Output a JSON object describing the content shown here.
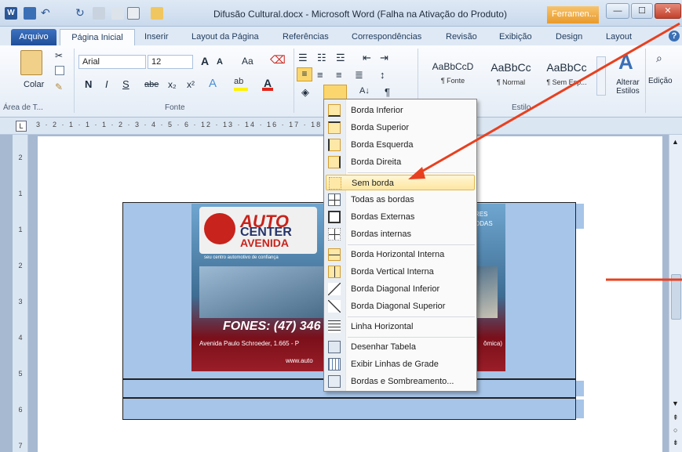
{
  "titlebar": {
    "title": "Difusão Cultural.docx - Microsoft Word (Falha na Ativação do Produto)",
    "context_tab": "Ferramen...",
    "min": "—",
    "max": "☐",
    "close": "✕"
  },
  "tabs": {
    "arquivo": "Arquivo",
    "inicio": "Página Inicial",
    "inserir": "Inserir",
    "layout_pagina": "Layout da Página",
    "referencias": "Referências",
    "correspondencias": "Correspondências",
    "revisao": "Revisão",
    "exibicao": "Exibição",
    "design": "Design",
    "layout": "Layout"
  },
  "ribbon": {
    "paste_label": "Colar",
    "clipboard_group": "Área de T...",
    "font_name": "Arial",
    "font_size": "12",
    "font_group": "Fonte",
    "bold": "N",
    "italic": "I",
    "underline": "S",
    "strike": "abe",
    "subscript": "x₂",
    "superscript": "x²",
    "grow": "A",
    "shrink": "A",
    "case": "Aa",
    "styles_group": "Estilo",
    "styles": [
      {
        "sample": "AaBbCcD⁠",
        "name": "¶ Fonte"
      },
      {
        "sample": "AaBbCc",
        "name": "¶ Normal"
      },
      {
        "sample": "AaBbCc",
        "name": "¶ Sem Esp..."
      }
    ],
    "alter_styles": "Alterar Estilos",
    "editing": "Edição",
    "pilcrow": "¶",
    "sort": "A↓"
  },
  "ruler": {
    "numbers": "3 · 2 · 1 · 1 · 1 · 2 · 3 · 4 · 5 · 6 · 12 · 13 · 14 · 16 · 17 · 18",
    "vertical": "2 1 1 2 3 4 5 6 7"
  },
  "banner": {
    "auto": "AUTO",
    "center": "CENTER",
    "avenida": "AVENIDA",
    "tagline": "seu centro automotivo de confiança",
    "fones": "FONES: (47) 346",
    "address": "Avenida Paulo Schroeder, 1.665 - P",
    "www": "www.auto",
    "right_text": "RES\nODAS",
    "right_bottom": "ômica)"
  },
  "menu": {
    "items": [
      {
        "label": "Borda Inferior",
        "icon": "border-bottom-icon"
      },
      {
        "label": "Borda Superior",
        "icon": "border-top-icon"
      },
      {
        "label": "Borda Esquerda",
        "icon": "border-left-icon"
      },
      {
        "label": "Borda Direita",
        "icon": "border-right-icon"
      },
      {
        "label": "Sem borda",
        "icon": "no-border-icon"
      },
      {
        "label": "Todas as bordas",
        "icon": "all-borders-icon"
      },
      {
        "label": "Bordas Externas",
        "icon": "outside-borders-icon"
      },
      {
        "label": "Bordas internas",
        "icon": "inside-borders-icon"
      },
      {
        "label": "Borda Horizontal Interna",
        "icon": "inside-horizontal-border-icon"
      },
      {
        "label": "Borda Vertical Interna",
        "icon": "inside-vertical-border-icon"
      },
      {
        "label": "Borda Diagonal Inferior",
        "icon": "diagonal-down-border-icon"
      },
      {
        "label": "Borda Diagonal Superior",
        "icon": "diagonal-up-border-icon"
      },
      {
        "label": "Linha Horizontal",
        "icon": "horizontal-line-icon"
      },
      {
        "label": "Desenhar Tabela",
        "icon": "draw-table-icon"
      },
      {
        "label": "Exibir Linhas de Grade",
        "icon": "view-gridlines-icon"
      },
      {
        "label": "Bordas e Sombreamento...",
        "icon": "borders-shading-icon"
      }
    ],
    "active_index": 4
  },
  "colors": {
    "annotation_red": "#e8401f",
    "cell_fill": "#a7c5e8"
  }
}
